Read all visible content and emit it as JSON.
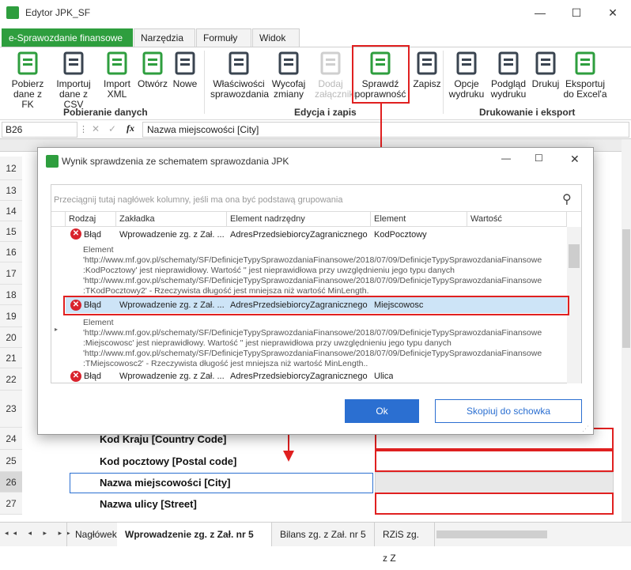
{
  "window": {
    "title": "Edytor JPK_SF"
  },
  "ribbon_tabs": [
    "e-Sprawozdanie finansowe",
    "Narzędzia",
    "Formuły",
    "Widok"
  ],
  "ribbon": {
    "buttons": [
      {
        "l1": "Pobierz",
        "l2": "dane z FK",
        "icon": "spreadsheet-icon"
      },
      {
        "l1": "Importuj",
        "l2": "dane z CSV",
        "icon": "import-csv-icon"
      },
      {
        "l1": "Import",
        "l2": "XML",
        "icon": "import-xml-icon"
      },
      {
        "l1": "Otwórz",
        "l2": "",
        "icon": "open-icon"
      },
      {
        "l1": "Nowe",
        "l2": "",
        "icon": "plus-icon"
      },
      {
        "l1": "Właściwości",
        "l2": "sprawozdania",
        "icon": "properties-icon"
      },
      {
        "l1": "Wycofaj",
        "l2": "zmiany",
        "icon": "undo-icon"
      },
      {
        "l1": "Dodaj",
        "l2": "załączniki",
        "icon": "paperclip-icon"
      },
      {
        "l1": "Sprawdź",
        "l2": "poprawność",
        "icon": "check-document-icon"
      },
      {
        "l1": "Zapisz",
        "l2": "",
        "icon": "save-icon"
      },
      {
        "l1": "Opcje",
        "l2": "wydruku",
        "icon": "print-options-icon"
      },
      {
        "l1": "Podgląd",
        "l2": "wydruku",
        "icon": "print-preview-icon"
      },
      {
        "l1": "Drukuj",
        "l2": "",
        "icon": "printer-icon"
      },
      {
        "l1": "Eksportuj",
        "l2": "do Excel'a",
        "icon": "excel-icon"
      }
    ],
    "groups": [
      "Pobieranie danych",
      "Edycja i zapis",
      "Drukowanie i eksport"
    ]
  },
  "formula_bar": {
    "cell": "B26",
    "content": "Nazwa miejscowości [City]"
  },
  "rows": {
    "numbers": [
      "12",
      "13",
      "14",
      "15",
      "16",
      "17",
      "18",
      "19",
      "20",
      "21",
      "22",
      "23",
      "24",
      "25",
      "26",
      "27"
    ],
    "labels": [
      "Kod Kraju [Country Code]",
      "Kod pocztowy [Postal code]",
      "Nazwa miejscowości [City]",
      "Nazwa ulicy [Street]"
    ]
  },
  "dialog": {
    "title": "Wynik sprawdzenia ze schematem sprawozdania JPK",
    "group_hint": "Przeciągnij tutaj nagłówek kolumny, jeśli ma ona być podstawą grupowania",
    "columns": [
      "Rodzaj",
      "Zakładka",
      "Element nadrzędny",
      "Element",
      "Wartość"
    ],
    "rows": [
      {
        "type": "Błąd",
        "tab": "Wprowadzenie zg. z Zał. ...",
        "parent": "AdresPrzedsiebiorcyZagranicznego",
        "element": "KodPocztowy",
        "value": "",
        "detail": [
          "Element",
          "'http://www.mf.gov.pl/schematy/SF/DefinicjeTypySprawozdaniaFinansowe/2018/07/09/DefinicjeTypySprawozdaniaFinansowe",
          ":KodPocztowy' jest nieprawidłowy. Wartość '' jest nieprawidłowa przy uwzględnieniu jego typu danych",
          "'http://www.mf.gov.pl/schematy/SF/DefinicjeTypySprawozdaniaFinansowe/2018/07/09/DefinicjeTypySprawozdaniaFinansowe",
          ":TKodPocztowy2' - Rzeczywista długość jest mniejsza niż wartość MinLength."
        ]
      },
      {
        "type": "Błąd",
        "tab": "Wprowadzenie zg. z Zał. ...",
        "parent": "AdresPrzedsiebiorcyZagranicznego",
        "element": "Miejscowosc",
        "value": "",
        "detail": [
          "Element",
          "'http://www.mf.gov.pl/schematy/SF/DefinicjeTypySprawozdaniaFinansowe/2018/07/09/DefinicjeTypySprawozdaniaFinansowe",
          ":Miejscowosc' jest nieprawidłowy. Wartość '' jest nieprawidłowa przy uwzględnieniu jego typu danych",
          "'http://www.mf.gov.pl/schematy/SF/DefinicjeTypySprawozdaniaFinansowe/2018/07/09/DefinicjeTypySprawozdaniaFinansowe",
          ":TMiejscowosc2' - Rzeczywista długość jest mniejsza niż wartość MinLength.."
        ]
      },
      {
        "type": "Błąd",
        "tab": "Wprowadzenie zg. z Zał. ...",
        "parent": "AdresPrzedsiebiorcyZagranicznego",
        "element": "Ulica",
        "value": "",
        "detail": []
      }
    ],
    "ok_label": "Ok",
    "copy_label": "Skopiuj do schowka"
  },
  "sheet_tabs": [
    "Nagłówek",
    "Wprowadzenie zg. z Zał. nr 5",
    "Bilans zg. z Zał. nr 5",
    "RZiS zg. z Z"
  ],
  "colors": {
    "accent": "#2e9e3e",
    "error": "#d9232d",
    "highlight": "#e02020",
    "selection": "#cde4f7"
  }
}
